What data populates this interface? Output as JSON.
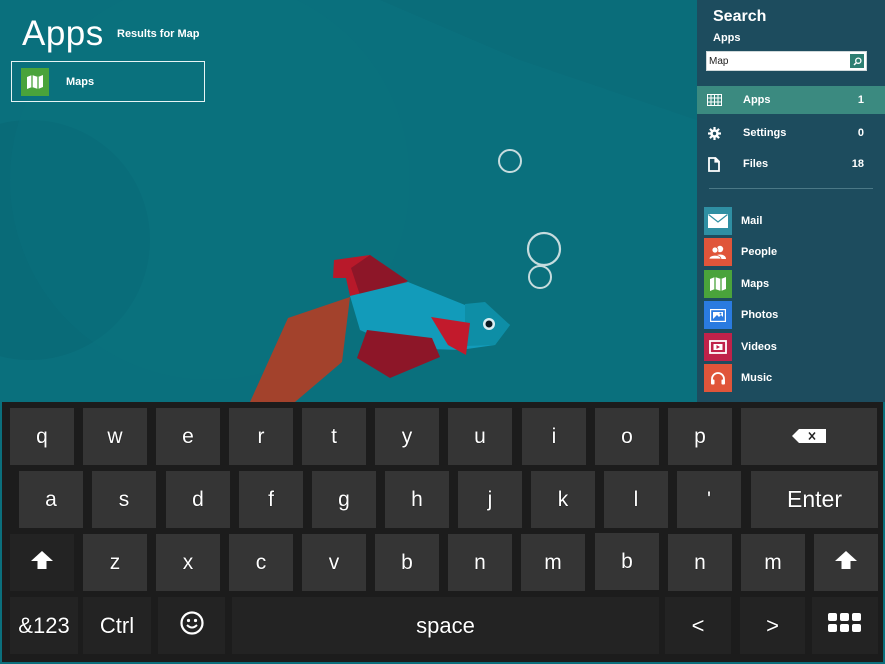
{
  "results": {
    "title": "Apps",
    "subtitle": "Results for Map",
    "items": [
      {
        "label": "Maps",
        "icon": "map-icon",
        "color": "#4aa33b"
      }
    ]
  },
  "search": {
    "title": "Search",
    "scope": "Apps",
    "query": "Map",
    "placeholder": "",
    "go_icon": "search-icon",
    "categories": [
      {
        "label": "Apps",
        "count": "1",
        "icon": "grid-icon",
        "active": true
      },
      {
        "label": "Settings",
        "count": "0",
        "icon": "gear-icon",
        "active": false
      },
      {
        "label": "Files",
        "count": "18",
        "icon": "file-icon",
        "active": false
      }
    ],
    "apps": [
      {
        "label": "Mail",
        "icon": "mail-icon",
        "color": "#2f8fa3"
      },
      {
        "label": "People",
        "icon": "people-icon",
        "color": "#e0553a"
      },
      {
        "label": "Maps",
        "icon": "map-icon",
        "color": "#4aa33b"
      },
      {
        "label": "Photos",
        "icon": "photos-icon",
        "color": "#2a7be0"
      },
      {
        "label": "Videos",
        "icon": "videos-icon",
        "color": "#c0224a"
      },
      {
        "label": "Music",
        "icon": "headphones-icon",
        "color": "#e0553a"
      }
    ]
  },
  "keyboard": {
    "row1": [
      "q",
      "w",
      "e",
      "r",
      "t",
      "y",
      "u",
      "i",
      "o",
      "p"
    ],
    "backspace_icon": "backspace-icon",
    "row2": [
      "a",
      "s",
      "d",
      "f",
      "g",
      "h",
      "j",
      "k",
      "l",
      "'"
    ],
    "enter": "Enter",
    "shift_icon": "shift-icon",
    "row3": [
      "z",
      "x",
      "c",
      "v",
      "b",
      "n",
      "m",
      "b",
      "n",
      "m"
    ],
    "symbols": "&123",
    "ctrl": "Ctrl",
    "emoji_icon": "emoji-icon",
    "space": "space",
    "left": "<",
    "right": ">",
    "layout_icon": "keyboard-layout-icon"
  }
}
